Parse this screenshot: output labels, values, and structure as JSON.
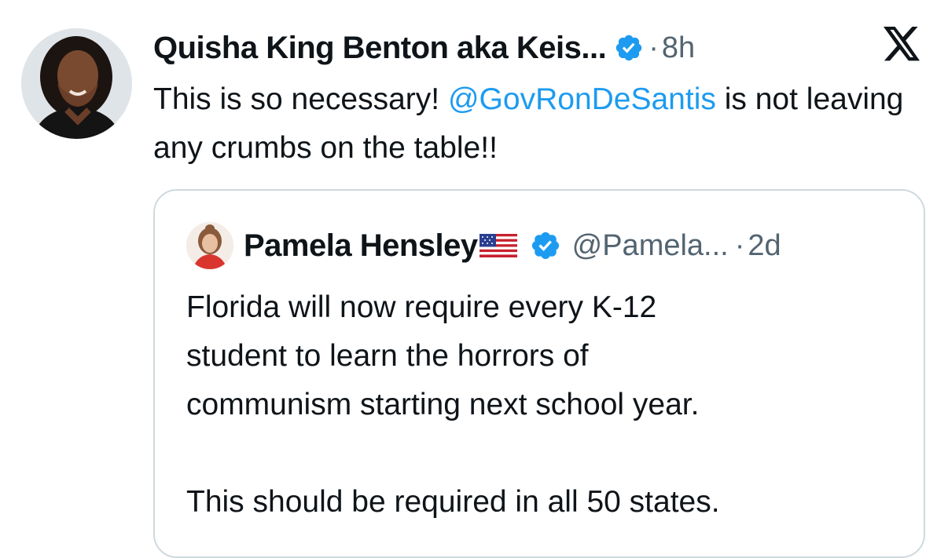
{
  "tweet": {
    "author_name": "Quisha King Benton aka Keis...",
    "verified": true,
    "separator": "·",
    "time": "8h",
    "text_before": "This is so necessary! ",
    "mention": "@GovRonDeSantis",
    "text_after": " is not leaving any crumbs on the table!!",
    "avatar_icon": "profile-photo"
  },
  "brand": {
    "logo_icon": "x-logo",
    "accent_color": "#1d9bf0"
  },
  "quoted_tweet": {
    "author_name": "Pamela Hensley",
    "flag_icon": "us-flag-icon",
    "verified": true,
    "handle": "@Pamela...",
    "separator": "·",
    "time": "2d",
    "lines": [
      "Florida will now require every K-12",
      "student to learn the horrors of",
      "communism starting next school year.",
      "",
      "This should be required in all 50 states."
    ]
  }
}
